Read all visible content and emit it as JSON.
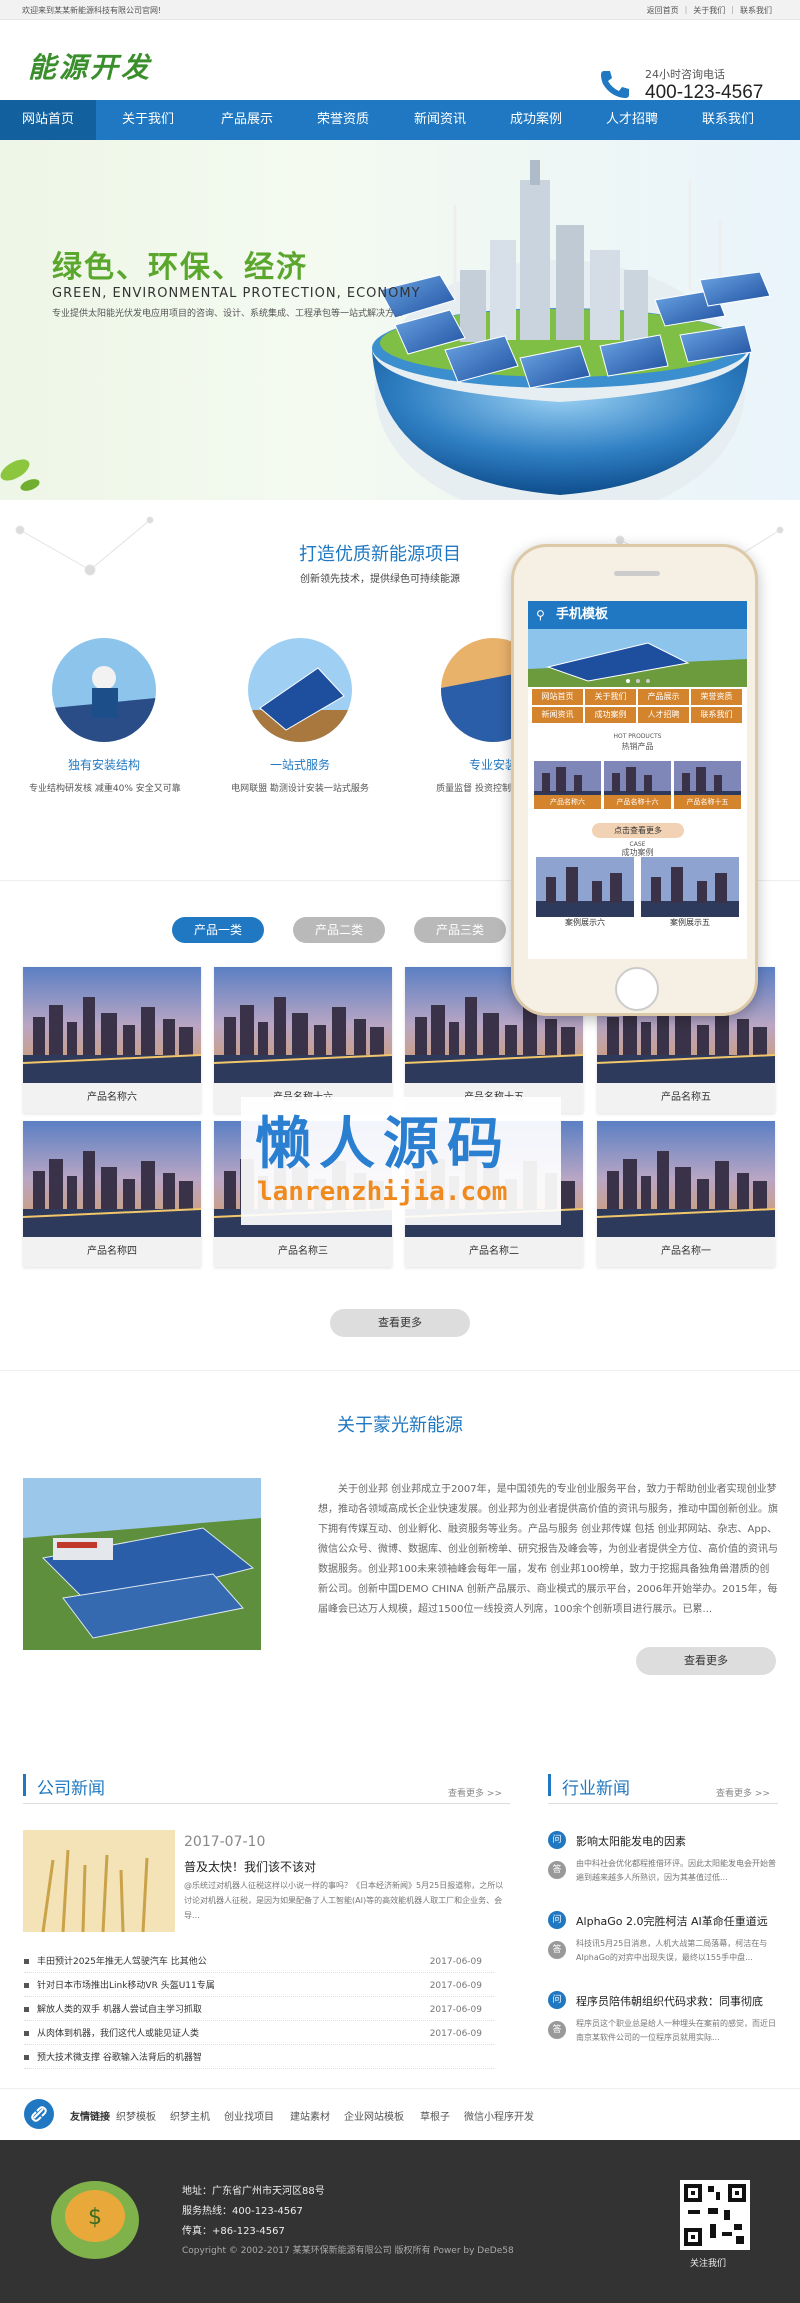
{
  "topbar": {
    "welcome": "欢迎来到某某新能源科技有限公司官网!",
    "links": [
      "返回首页",
      "关于我们",
      "联系我们"
    ]
  },
  "header": {
    "logo": "能源开发",
    "hotline_label": "24小时咨询电话",
    "hotline_number": "400-123-4567"
  },
  "nav": {
    "items": [
      "网站首页",
      "关于我们",
      "产品展示",
      "荣誉资质",
      "新闻资讯",
      "成功案例",
      "人才招聘",
      "联系我们"
    ]
  },
  "banner": {
    "title": "绿色、环保、经济",
    "subtitle_en": "GREEN, ENVIRONMENTAL PROTECTION, ECONOMY",
    "desc": "专业提供太阳能光伏发电应用项目的咨询、设计、系统集成、工程承包等一站式解决方..."
  },
  "projects": {
    "title": "打造优质新能源项目",
    "subtitle": "创新领先技术，提供绿色可持续能源",
    "items": [
      {
        "title": "独有安装结构",
        "desc": "专业结构研发核 减重40% 安全又可靠"
      },
      {
        "title": "一站式服务",
        "desc": "电网联盟 勘测设计安装一站式服务"
      },
      {
        "title": "专业安装",
        "desc": "质量监督 投资控制 售后服务"
      }
    ]
  },
  "mobile": {
    "title": "手机模板",
    "nav": [
      "网站首页",
      "关于我们",
      "产品展示",
      "荣誉资质",
      "新闻资讯",
      "成功案例",
      "人才招聘",
      "联系我们"
    ],
    "hot_en": "HOT PRODUCTS",
    "hot_cn": "热销产品",
    "products": [
      "产品名称六",
      "产品名称十六",
      "产品名称十五"
    ],
    "more": "点击查看更多",
    "case_en": "CASE",
    "case_cn": "成功案例",
    "cases": [
      "案例展示六",
      "案例展示五"
    ]
  },
  "products": {
    "tabs": [
      "产品一类",
      "产品二类",
      "产品三类"
    ],
    "items": [
      "产品名称六",
      "产品名称十六",
      "产品名称十五",
      "产品名称五",
      "产品名称四",
      "产品名称三",
      "产品名称二",
      "产品名称一"
    ],
    "more": "查看更多"
  },
  "watermark": {
    "cn": "懒人源码",
    "url": "lanrenzhijia.com"
  },
  "about": {
    "title": "关于蒙光新能源",
    "text": "关于创业邦 创业邦成立于2007年，是中国领先的专业创业服务平台，致力于帮助创业者实现创业梦想，推动各领域高成长企业快速发展。创业邦为创业者提供高价值的资讯与服务，推动中国创新创业。旗下拥有传媒互动、创业孵化、融资服务等业务。产品与服务 创业邦传媒 包括 创业邦网站、杂志、App、微信公众号、微博、数据库、创业创新榜单、研究报告及峰会等，为创业者提供全方位、高价值的资讯与数据服务。创业邦100未来领袖峰会每年一届，发布 创业邦100榜单，致力于挖掘具备独角兽潜质的创新公司。创新中国DEMO CHINA 创新产品展示、商业模式的展示平台，2006年开始举办。2015年，每届峰会已达万人规模，超过1500位一线投资人列席，100余个创新项目进行展示。已累...",
    "more": "查看更多"
  },
  "company_news": {
    "title": "公司新闻",
    "more": "查看更多 >>",
    "featured": {
      "date": "2017-07-10",
      "title": "普及太快！我们该不该对",
      "desc": "@乐统过对机器人征税这样以小说一样的事吗？《日本经济新闻》5月25日报道称，之所以讨论对机器人征税，是因为如果配备了人工智能(AI)等的高效能机器人取工厂和企业务、会导..."
    },
    "list": [
      {
        "title": "丰田预计2025年推无人驾驶汽车 比其他公",
        "date": "2017-06-09"
      },
      {
        "title": "针对日本市场推出Link移动VR 头盔U11专属",
        "date": "2017-06-09"
      },
      {
        "title": "解放人类的双手 机器人尝试自主学习抓取",
        "date": "2017-06-09"
      },
      {
        "title": "从肉体到机器，我们这代人或能见证人类",
        "date": "2017-06-09"
      },
      {
        "title": "预大技术微支撑 谷歌输入法背后的机器智",
        "date": "2017-06-09"
      }
    ]
  },
  "industry_news": {
    "title": "行业新闻",
    "more": "查看更多 >>",
    "items": [
      {
        "q": "影响太阳能发电的因素",
        "a": "由中科社会优化都程推借环评。因此太阳能发电会开始普遍到越来越多人所熟识，因为其基值过低..."
      },
      {
        "q": "AlphaGo 2.0完胜柯洁 AI革命任重道远",
        "a": "科技讯5月25日消息，人机大战第二局落幕，柯洁在与AlphaGo的对弈中出现失误，最终以155手中盘..."
      },
      {
        "q": "程序员陪伟朝组织代码求救：同事彻底",
        "a": "程序员这个职业总是给人一种埋头在案前的感觉，而近日南京某软件公司的一位程序员就用实际..."
      }
    ]
  },
  "links": {
    "label": "友情链接",
    "items": [
      "织梦模板",
      "织梦主机",
      "创业找项目",
      "建站素材",
      "企业网站模板",
      "草根子",
      "微信小程序开发"
    ]
  },
  "footer": {
    "address": "地址：广东省广州市天河区88号",
    "hotline": "服务热线：400-123-4567",
    "fax": "传真：+86-123-4567",
    "copyright": "Copyright © 2002-2017 某某环保新能源有限公司 版权所有 Power by DeDe58",
    "qr_label": "关注我们"
  },
  "colors": {
    "primary": "#1f78c1",
    "green": "#5ba72e",
    "orange": "#d4842d",
    "footer": "#333333"
  }
}
